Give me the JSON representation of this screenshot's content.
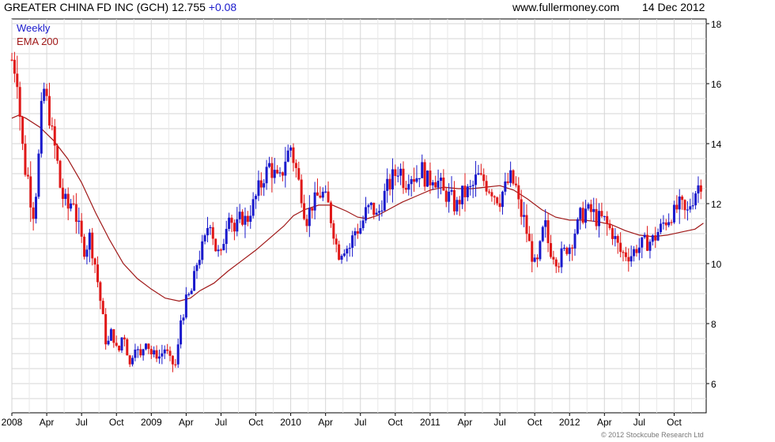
{
  "header": {
    "title": "GREATER CHINA FD INC (GCH) 12.755",
    "change": "+0.08",
    "site": "www.fullermoney.com",
    "date": "14 Dec 2012"
  },
  "copyright": "© 2012 Stockcube Research Ltd",
  "chart_data": {
    "type": "candlestick",
    "legend": [
      {
        "label": "Weekly",
        "color": "#1a1acc"
      },
      {
        "label": "EMA 200",
        "color": "#a01818"
      }
    ],
    "ylim": [
      5,
      18
    ],
    "yticks": [
      6,
      8,
      10,
      12,
      14,
      16,
      18
    ],
    "xlim": [
      2008.0,
      2012.98
    ],
    "xticks": [
      {
        "label": "2008",
        "t": 2008.0
      },
      {
        "label": "Apr",
        "t": 2008.25
      },
      {
        "label": "Jul",
        "t": 2008.5
      },
      {
        "label": "Oct",
        "t": 2008.75
      },
      {
        "label": "2009",
        "t": 2009.0
      },
      {
        "label": "Apr",
        "t": 2009.25
      },
      {
        "label": "Jul",
        "t": 2009.5
      },
      {
        "label": "Oct",
        "t": 2009.75
      },
      {
        "label": "2010",
        "t": 2010.0
      },
      {
        "label": "Apr",
        "t": 2010.25
      },
      {
        "label": "Jul",
        "t": 2010.5
      },
      {
        "label": "Oct",
        "t": 2010.75
      },
      {
        "label": "2011",
        "t": 2011.0
      },
      {
        "label": "Apr",
        "t": 2011.25
      },
      {
        "label": "Jul",
        "t": 2011.5
      },
      {
        "label": "Oct",
        "t": 2011.75
      },
      {
        "label": "2012",
        "t": 2012.0
      },
      {
        "label": "Apr",
        "t": 2012.25
      },
      {
        "label": "Jul",
        "t": 2012.5
      },
      {
        "label": "Oct",
        "t": 2012.75
      }
    ],
    "up_color": "#1a1acc",
    "down_color": "#e01818",
    "grid": true,
    "series": [
      {
        "name": "Weekly",
        "price_keypoints": [
          [
            2008.0,
            16.8
          ],
          [
            2008.04,
            16.3
          ],
          [
            2008.06,
            14.8
          ],
          [
            2008.09,
            13.2
          ],
          [
            2008.12,
            12.8
          ],
          [
            2008.15,
            11.6
          ],
          [
            2008.18,
            12.6
          ],
          [
            2008.21,
            14.9
          ],
          [
            2008.23,
            15.8
          ],
          [
            2008.26,
            15.2
          ],
          [
            2008.29,
            14.2
          ],
          [
            2008.32,
            13.6
          ],
          [
            2008.35,
            12.4
          ],
          [
            2008.4,
            11.8
          ],
          [
            2008.44,
            12.2
          ],
          [
            2008.47,
            11.3
          ],
          [
            2008.52,
            10.4
          ],
          [
            2008.56,
            10.9
          ],
          [
            2008.6,
            9.9
          ],
          [
            2008.64,
            8.6
          ],
          [
            2008.68,
            7.2
          ],
          [
            2008.72,
            7.8
          ],
          [
            2008.76,
            6.9
          ],
          [
            2008.8,
            7.8
          ],
          [
            2008.85,
            6.5
          ],
          [
            2008.88,
            7.4
          ],
          [
            2008.92,
            6.8
          ],
          [
            2008.96,
            7.5
          ],
          [
            2009.0,
            7.0
          ],
          [
            2009.06,
            6.9
          ],
          [
            2009.1,
            7.2
          ],
          [
            2009.14,
            6.7
          ],
          [
            2009.18,
            6.6
          ],
          [
            2009.21,
            8.1
          ],
          [
            2009.25,
            8.7
          ],
          [
            2009.29,
            9.1
          ],
          [
            2009.33,
            10.1
          ],
          [
            2009.38,
            10.7
          ],
          [
            2009.42,
            11.6
          ],
          [
            2009.46,
            10.5
          ],
          [
            2009.5,
            10.2
          ],
          [
            2009.53,
            11.2
          ],
          [
            2009.56,
            11.8
          ],
          [
            2009.6,
            11.0
          ],
          [
            2009.64,
            11.6
          ],
          [
            2009.68,
            11.4
          ],
          [
            2009.72,
            11.9
          ],
          [
            2009.76,
            12.3
          ],
          [
            2009.8,
            12.8
          ],
          [
            2009.85,
            13.3
          ],
          [
            2009.88,
            13.0
          ],
          [
            2009.92,
            12.7
          ],
          [
            2009.96,
            13.5
          ],
          [
            2010.0,
            13.9
          ],
          [
            2010.04,
            13.1
          ],
          [
            2010.08,
            12.2
          ],
          [
            2010.11,
            11.5
          ],
          [
            2010.15,
            11.9
          ],
          [
            2010.19,
            12.2
          ],
          [
            2010.22,
            12.4
          ],
          [
            2010.26,
            12.1
          ],
          [
            2010.3,
            11.3
          ],
          [
            2010.34,
            10.3
          ],
          [
            2010.38,
            10.6
          ],
          [
            2010.42,
            10.5
          ],
          [
            2010.46,
            11.1
          ],
          [
            2010.5,
            11.2
          ],
          [
            2010.54,
            11.7
          ],
          [
            2010.58,
            11.9
          ],
          [
            2010.62,
            11.5
          ],
          [
            2010.66,
            12.2
          ],
          [
            2010.7,
            12.6
          ],
          [
            2010.74,
            12.9
          ],
          [
            2010.78,
            13.2
          ],
          [
            2010.82,
            12.7
          ],
          [
            2010.86,
            13.0
          ],
          [
            2010.9,
            12.9
          ],
          [
            2010.94,
            13.2
          ],
          [
            2010.98,
            12.7
          ],
          [
            2011.02,
            12.9
          ],
          [
            2011.06,
            12.7
          ],
          [
            2011.1,
            12.3
          ],
          [
            2011.14,
            12.2
          ],
          [
            2011.18,
            11.9
          ],
          [
            2011.22,
            12.2
          ],
          [
            2011.26,
            12.4
          ],
          [
            2011.3,
            12.5
          ],
          [
            2011.34,
            12.9
          ],
          [
            2011.38,
            12.8
          ],
          [
            2011.42,
            12.6
          ],
          [
            2011.46,
            12.3
          ],
          [
            2011.5,
            12.2
          ],
          [
            2011.54,
            12.6
          ],
          [
            2011.58,
            12.8
          ],
          [
            2011.62,
            12.5
          ],
          [
            2011.64,
            11.8
          ],
          [
            2011.67,
            11.5
          ],
          [
            2011.7,
            10.9
          ],
          [
            2011.73,
            10.3
          ],
          [
            2011.76,
            9.7
          ],
          [
            2011.79,
            10.6
          ],
          [
            2011.82,
            11.4
          ],
          [
            2011.85,
            10.6
          ],
          [
            2011.88,
            10.3
          ],
          [
            2011.92,
            10.1
          ],
          [
            2011.96,
            10.4
          ],
          [
            2012.0,
            10.6
          ],
          [
            2012.04,
            11.1
          ],
          [
            2012.08,
            11.6
          ],
          [
            2012.12,
            11.8
          ],
          [
            2012.16,
            11.7
          ],
          [
            2012.2,
            11.5
          ],
          [
            2012.24,
            11.5
          ],
          [
            2012.28,
            11.2
          ],
          [
            2012.32,
            10.9
          ],
          [
            2012.36,
            10.4
          ],
          [
            2012.4,
            10.3
          ],
          [
            2012.44,
            10.3
          ],
          [
            2012.48,
            10.5
          ],
          [
            2012.52,
            10.6
          ],
          [
            2012.56,
            10.7
          ],
          [
            2012.6,
            10.8
          ],
          [
            2012.64,
            11.1
          ],
          [
            2012.68,
            11.4
          ],
          [
            2012.72,
            11.6
          ],
          [
            2012.76,
            11.8
          ],
          [
            2012.8,
            11.9
          ],
          [
            2012.84,
            11.6
          ],
          [
            2012.87,
            12.1
          ],
          [
            2012.9,
            12.4
          ],
          [
            2012.94,
            12.75
          ]
        ]
      },
      {
        "name": "EMA 200",
        "points": [
          [
            2008.0,
            14.85
          ],
          [
            2008.05,
            14.95
          ],
          [
            2008.1,
            14.85
          ],
          [
            2008.2,
            14.55
          ],
          [
            2008.3,
            14.1
          ],
          [
            2008.4,
            13.5
          ],
          [
            2008.5,
            12.7
          ],
          [
            2008.6,
            11.7
          ],
          [
            2008.7,
            10.8
          ],
          [
            2008.8,
            10.0
          ],
          [
            2008.9,
            9.5
          ],
          [
            2009.0,
            9.15
          ],
          [
            2009.1,
            8.85
          ],
          [
            2009.2,
            8.75
          ],
          [
            2009.28,
            8.85
          ],
          [
            2009.35,
            9.1
          ],
          [
            2009.45,
            9.35
          ],
          [
            2009.55,
            9.75
          ],
          [
            2009.65,
            10.1
          ],
          [
            2009.75,
            10.45
          ],
          [
            2009.85,
            10.85
          ],
          [
            2009.95,
            11.25
          ],
          [
            2010.02,
            11.6
          ],
          [
            2010.1,
            11.8
          ],
          [
            2010.2,
            11.95
          ],
          [
            2010.3,
            11.95
          ],
          [
            2010.4,
            11.75
          ],
          [
            2010.48,
            11.55
          ],
          [
            2010.55,
            11.5
          ],
          [
            2010.62,
            11.6
          ],
          [
            2010.7,
            11.8
          ],
          [
            2010.8,
            12.05
          ],
          [
            2010.9,
            12.25
          ],
          [
            2011.0,
            12.45
          ],
          [
            2011.1,
            12.55
          ],
          [
            2011.2,
            12.5
          ],
          [
            2011.3,
            12.5
          ],
          [
            2011.4,
            12.55
          ],
          [
            2011.5,
            12.6
          ],
          [
            2011.6,
            12.45
          ],
          [
            2011.7,
            12.15
          ],
          [
            2011.8,
            11.8
          ],
          [
            2011.9,
            11.55
          ],
          [
            2012.0,
            11.45
          ],
          [
            2012.1,
            11.45
          ],
          [
            2012.2,
            11.4
          ],
          [
            2012.3,
            11.3
          ],
          [
            2012.4,
            11.1
          ],
          [
            2012.5,
            10.95
          ],
          [
            2012.6,
            10.9
          ],
          [
            2012.7,
            10.95
          ],
          [
            2012.8,
            11.05
          ],
          [
            2012.9,
            11.15
          ],
          [
            2012.96,
            11.35
          ]
        ]
      }
    ]
  }
}
